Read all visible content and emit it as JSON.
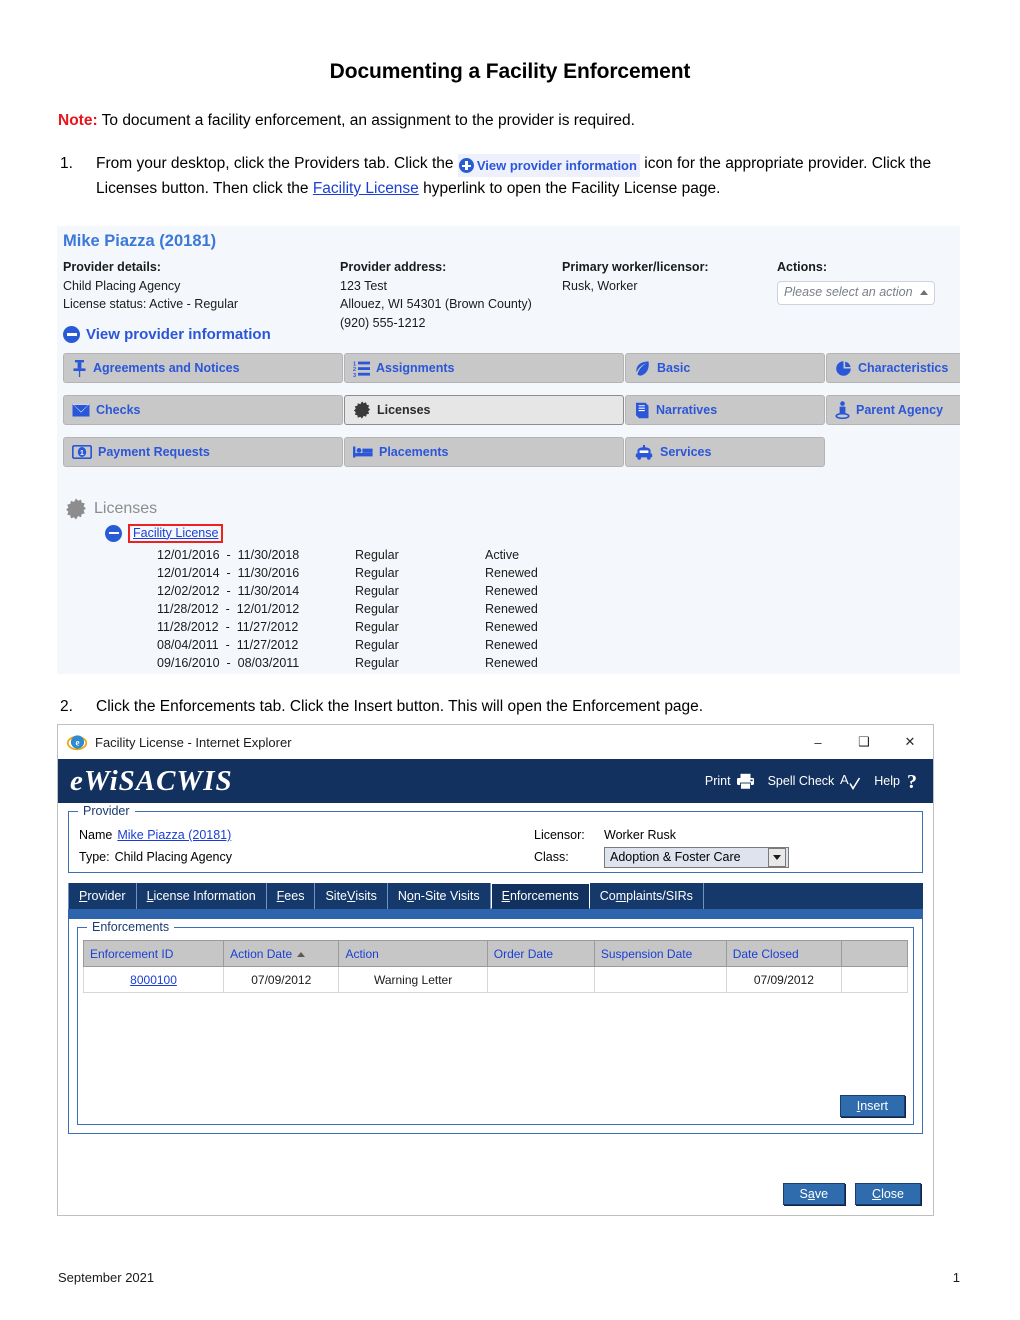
{
  "document": {
    "title": "Documenting a Facility Enforcement",
    "note_label": "Note:",
    "note_text": " To document a facility enforcement, an assignment to the provider is required.",
    "steps": [
      {
        "number": "1.",
        "part1": "From your desktop, click the Providers tab. Click the ",
        "chip_icon": "plus-circle-icon",
        "chip_label": "View provider information",
        "part2": " icon for the appropriate provider. Click the Licenses button. Then click the ",
        "link": "Facility License",
        "part3": " hyperlink to open the Facility License page."
      },
      {
        "number": "2.",
        "part1": "Click the Enforcements tab. Click the Insert button. This will open the Enforcement page."
      }
    ],
    "footer": {
      "left": "September 2021",
      "right": "1"
    }
  },
  "screenshot1": {
    "provider_name": "Mike Piazza (20181)",
    "columns": {
      "details": {
        "heading": "Provider details:",
        "lines": [
          "Child Placing Agency",
          "License status: Active - Regular"
        ]
      },
      "address": {
        "heading": "Provider address:",
        "lines": [
          "123 Test",
          "Allouez, WI 54301 (Brown County)",
          "(920) 555-1212"
        ]
      },
      "worker": {
        "heading": "Primary worker/licensor:",
        "lines": [
          "Rusk, Worker"
        ]
      },
      "actions": {
        "heading": "Actions:",
        "select_value": "Please select an action"
      }
    },
    "view_provider_information": {
      "icon": "minus-circle-icon",
      "label": "View provider information"
    },
    "buttons": [
      {
        "label": "Agreements and Notices",
        "icon": "pushpin-icon",
        "selected": false
      },
      {
        "label": "Assignments",
        "icon": "numbered-list-icon",
        "selected": false
      },
      {
        "label": "Basic",
        "icon": "leaf-icon",
        "selected": false
      },
      {
        "label": "Characteristics",
        "icon": "pie-chart-icon",
        "selected": false
      },
      {
        "label": "Checks",
        "icon": "envelope-icon",
        "selected": false
      },
      {
        "label": "Licenses",
        "icon": "badge-burst-icon",
        "selected": true
      },
      {
        "label": "Narratives",
        "icon": "book-icon",
        "selected": false
      },
      {
        "label": "Parent Agency",
        "icon": "person-pedestal-icon",
        "selected": false
      },
      {
        "label": "Payment Requests",
        "icon": "banknote-icon",
        "selected": false
      },
      {
        "label": "Placements",
        "icon": "bed-icon",
        "selected": false
      },
      {
        "label": "Services",
        "icon": "car-icon",
        "selected": false
      }
    ],
    "licenses": {
      "heading": "Licenses",
      "icon": "badge-burst-icon",
      "node_icon": "minus-circle-icon",
      "node_link": "Facility License",
      "rows": [
        {
          "dates": "12/01/2016  -  11/30/2018",
          "type": "Regular",
          "status": "Active"
        },
        {
          "dates": "12/01/2014  -  11/30/2016",
          "type": "Regular",
          "status": "Renewed"
        },
        {
          "dates": "12/02/2012  -  11/30/2014",
          "type": "Regular",
          "status": "Renewed"
        },
        {
          "dates": "11/28/2012  -  12/01/2012",
          "type": "Regular",
          "status": "Renewed"
        },
        {
          "dates": "11/28/2012  -  11/27/2012",
          "type": "Regular",
          "status": "Renewed"
        },
        {
          "dates": "08/04/2011  -  11/27/2012",
          "type": "Regular",
          "status": "Renewed"
        },
        {
          "dates": "09/16/2010  -  08/03/2011",
          "type": "Regular",
          "status": "Renewed"
        }
      ]
    }
  },
  "screenshot2": {
    "window": {
      "icon": "internet-explorer-icon",
      "title": "Facility License - Internet Explorer",
      "minimize": "–",
      "maximize": "❑",
      "close": "✕"
    },
    "banner": {
      "logo": "eWiSACWIS",
      "tools": [
        {
          "label": "Print",
          "icon": "printer-icon"
        },
        {
          "label": "Spell Check",
          "icon": "spellcheck-icon"
        },
        {
          "label": "Help",
          "icon": "question-mark-icon"
        }
      ]
    },
    "provider_fieldset": {
      "legend": "Provider",
      "name_label": "Name",
      "name_value": "Mike Piazza  (20181)",
      "type_label": "Type:",
      "type_value": "Child Placing Agency",
      "licensor_label": "Licensor:",
      "licensor_value": "Worker Rusk",
      "class_label": "Class:",
      "class_value": "Adoption & Foster Care"
    },
    "tabs": [
      {
        "label": "Provider",
        "accesskey_index": 0,
        "active": false
      },
      {
        "label": "License Information",
        "accesskey_index": 0,
        "active": false
      },
      {
        "label": "Fees",
        "accesskey_index": 0,
        "active": false
      },
      {
        "label": "Site Visits",
        "accesskey_index": 5,
        "active": false
      },
      {
        "label": "Non-Site Visits",
        "accesskey_index": 2,
        "active": false
      },
      {
        "label": "Enforcements",
        "accesskey_index": 0,
        "active": true
      },
      {
        "label": "Complaints/SIRs",
        "accesskey_index": 2,
        "active": false
      }
    ],
    "enforcements": {
      "legend": "Enforcements",
      "columns": [
        "Enforcement ID",
        "Action Date",
        "Action",
        "Order Date",
        "Suspension Date",
        "Date Closed",
        ""
      ],
      "sorted_column": "Action Date",
      "sort_direction": "asc",
      "rows": [
        {
          "enforcement_id": "8000100",
          "action_date": "07/09/2012",
          "action": "Warning Letter",
          "order_date": "",
          "suspension_date": "",
          "date_closed": "07/09/2012",
          "extra": ""
        }
      ],
      "insert_button": "Insert"
    },
    "footer_buttons": [
      {
        "label": "Save",
        "accesskey_index": 1
      },
      {
        "label": "Close",
        "accesskey_index": 0
      }
    ]
  },
  "colors": {
    "note_red": "#e8141a",
    "link_blue": "#1a3fd4",
    "accent_blue": "#2b56d8",
    "banner_navy": "#13315f",
    "button_blue": "#2f6cae",
    "highlight_red": "#ef2020"
  }
}
